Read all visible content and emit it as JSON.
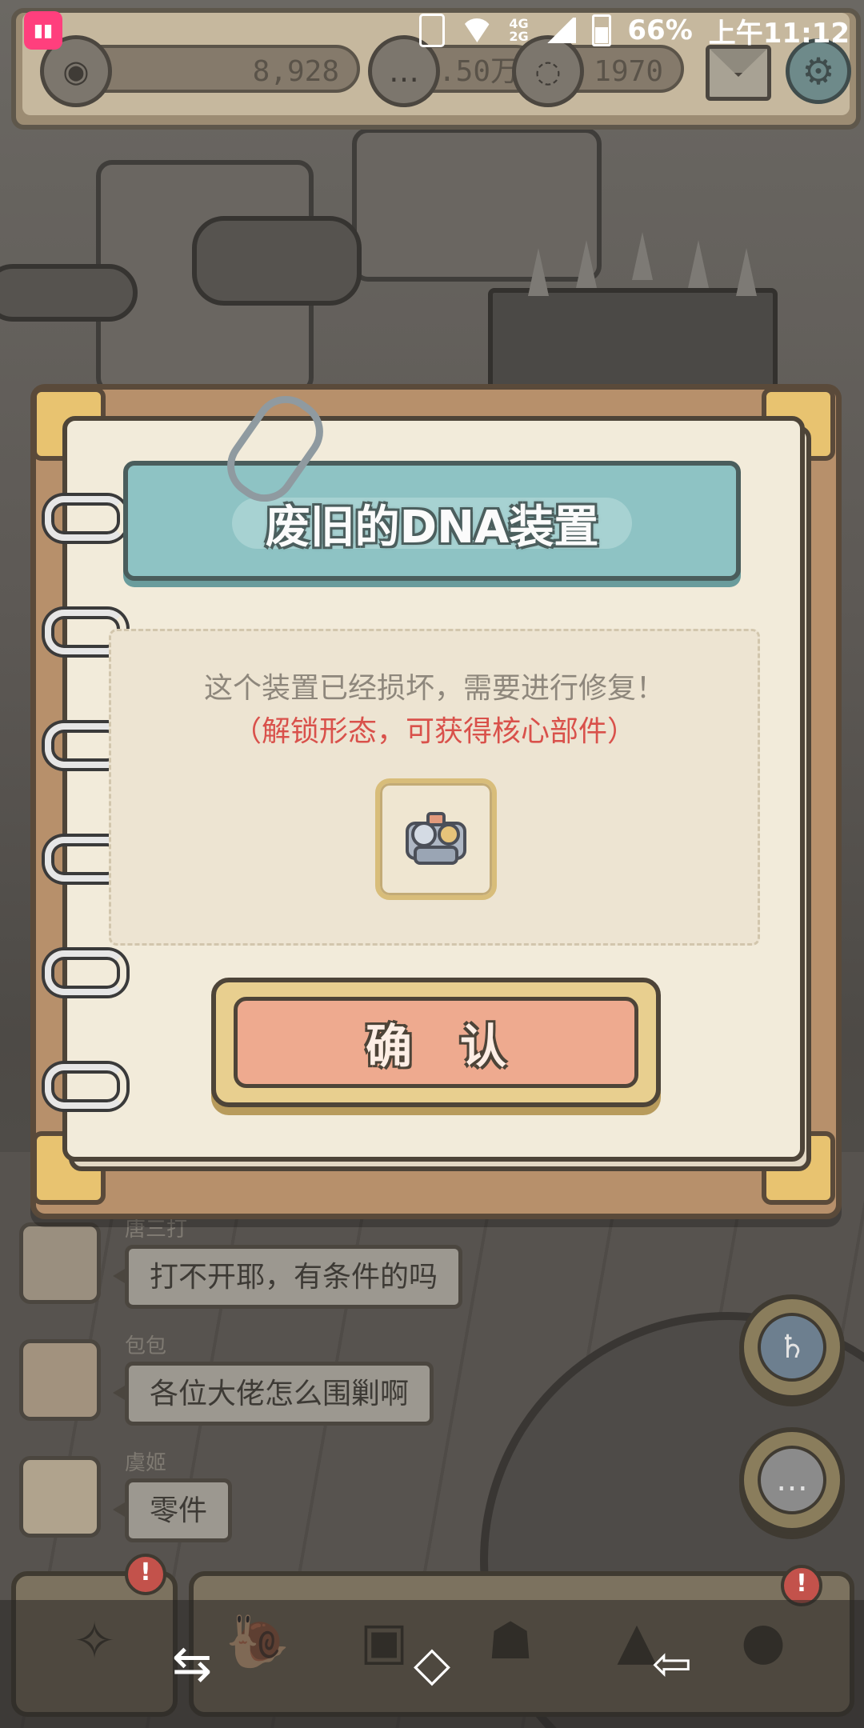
{
  "status_bar": {
    "network": "4G 2G",
    "battery": "66%",
    "time": "上午11:12"
  },
  "resources": {
    "eye_value": "8,928",
    "bubble1_value": "3.50万",
    "bubble2_value": "1970"
  },
  "dialog": {
    "title": "废旧的DNA装置",
    "message": "这个装置已经损坏，需要进行修复！",
    "hint": "（解锁形态，可获得核心部件）",
    "confirm_label": "确认",
    "item_icon": "dna-device-part-icon"
  },
  "chat": [
    {
      "name": "唐三打",
      "text": "打不开耶，有条件的吗"
    },
    {
      "name": "包包",
      "text": "各位大佬怎么围剿啊"
    },
    {
      "name": "虞姬",
      "text": "零件"
    }
  ],
  "notification_badge": "!",
  "nav": {
    "back": "⇦",
    "home": "◇",
    "recent": "⇆"
  },
  "colors": {
    "title_banner": "#8ec3c4",
    "confirm_button": "#eeaa8f",
    "hint_text": "#d9514b"
  }
}
